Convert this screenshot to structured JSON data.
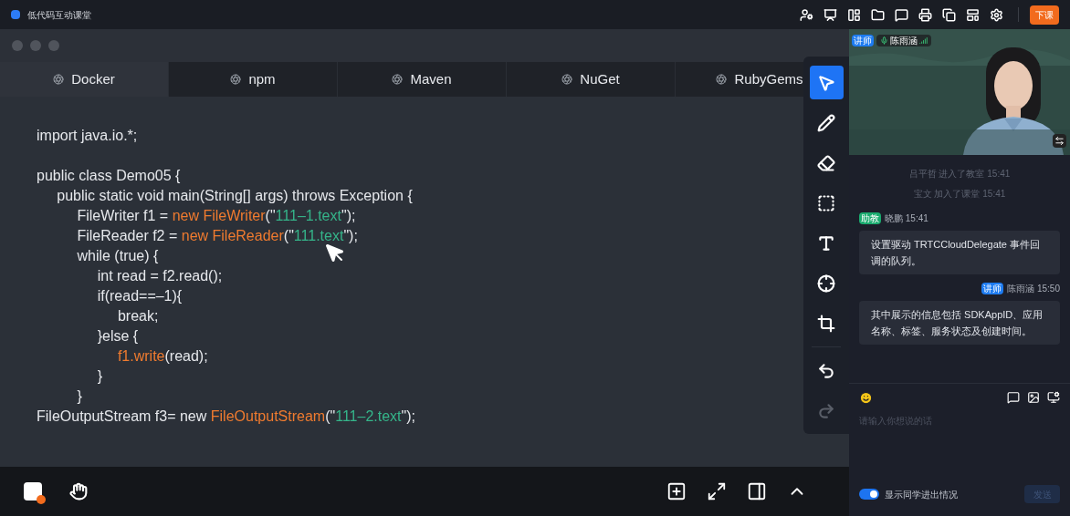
{
  "app": {
    "title": "低代码互动课堂",
    "end_button": "下课"
  },
  "tabs": [
    {
      "label": "Docker",
      "selected": true
    },
    {
      "label": "npm",
      "selected": false
    },
    {
      "label": "Maven",
      "selected": false
    },
    {
      "label": "NuGet",
      "selected": false
    },
    {
      "label": "RubyGems",
      "selected": false
    }
  ],
  "code": [
    {
      "kind": "code",
      "segments": [
        {
          "kind": "plain",
          "text": "import java.io.*;"
        }
      ]
    },
    {
      "kind": "blank"
    },
    {
      "kind": "code",
      "segments": [
        {
          "kind": "plain",
          "text": "public class Demo05 {"
        }
      ]
    },
    {
      "kind": "code",
      "segments": [
        {
          "kind": "plain",
          "text": "     public static void main(String[] args) throws Exception {"
        }
      ]
    },
    {
      "kind": "code",
      "segments": [
        {
          "kind": "plain",
          "text": "          FileWriter f1 = "
        },
        {
          "kind": "call",
          "text": "new FileWriter"
        },
        {
          "kind": "plain",
          "text": "(\""
        },
        {
          "kind": "string",
          "text": "111–1.text"
        },
        {
          "kind": "plain",
          "text": "\");"
        }
      ]
    },
    {
      "kind": "code",
      "segments": [
        {
          "kind": "plain",
          "text": "          FileReader f2 = "
        },
        {
          "kind": "call",
          "text": "new FileReader"
        },
        {
          "kind": "plain",
          "text": "(\""
        },
        {
          "kind": "string",
          "text": "111.text"
        },
        {
          "kind": "plain",
          "text": "\");"
        }
      ]
    },
    {
      "kind": "code",
      "segments": [
        {
          "kind": "plain",
          "text": "          while (true) {"
        }
      ]
    },
    {
      "kind": "code",
      "segments": [
        {
          "kind": "plain",
          "text": "               int read = f2.read();"
        }
      ]
    },
    {
      "kind": "code",
      "segments": [
        {
          "kind": "plain",
          "text": "               if(read==–1){"
        }
      ]
    },
    {
      "kind": "code",
      "segments": [
        {
          "kind": "plain",
          "text": "                    break;"
        }
      ]
    },
    {
      "kind": "code",
      "segments": [
        {
          "kind": "plain",
          "text": "               }else {"
        }
      ]
    },
    {
      "kind": "code",
      "segments": [
        {
          "kind": "call",
          "text": "                    f1.write"
        },
        {
          "kind": "plain",
          "text": "(read);"
        }
      ]
    },
    {
      "kind": "code",
      "segments": [
        {
          "kind": "plain",
          "text": "               }"
        }
      ]
    },
    {
      "kind": "code",
      "segments": [
        {
          "kind": "plain",
          "text": "          }"
        }
      ]
    },
    {
      "kind": "code",
      "segments": [
        {
          "kind": "plain",
          "text": "FileOutputStream f3= new "
        },
        {
          "kind": "call",
          "text": "FileOutputStream"
        },
        {
          "kind": "plain",
          "text": "(\""
        },
        {
          "kind": "string",
          "text": "111–2.text"
        },
        {
          "kind": "plain",
          "text": "\");"
        }
      ]
    }
  ],
  "tools": [
    {
      "selected": true,
      "disabled": false
    },
    {
      "selected": false,
      "disabled": false
    },
    {
      "selected": false,
      "disabled": false
    },
    {
      "selected": false,
      "disabled": false
    },
    {
      "selected": false,
      "disabled": false
    },
    {
      "selected": false,
      "disabled": false
    },
    {
      "selected": false,
      "disabled": false
    },
    {
      "selected": false,
      "disabled": false
    },
    {
      "selected": false,
      "disabled": true
    }
  ],
  "video": {
    "role_badge": "讲师",
    "name": "陈雨涵"
  },
  "chat": {
    "system_messages": [
      "吕平哲 进入了教室 15:41",
      "宝文 加入了课堂 15:41"
    ],
    "messages": [
      {
        "kind": "assistant",
        "badge": "助教",
        "color": "#1aab6f",
        "sender": "晓鹏 15:41",
        "text": "设置驱动 TRTCCloudDelegate 事件回调的队列。"
      },
      {
        "kind": "teacher",
        "badge": "讲师",
        "color": "#1d7bf0",
        "sender": "陈雨涵 15:50",
        "text": "其中展示的信息包括 SDKAppID、应用名称、标签、服务状态及创建时间。"
      }
    ],
    "input": {
      "placeholder": "请输入你想说的话"
    },
    "toggle": {
      "label": "显示同学进出情况",
      "on": true
    },
    "send": {
      "label": "发送",
      "disabled": true
    }
  }
}
